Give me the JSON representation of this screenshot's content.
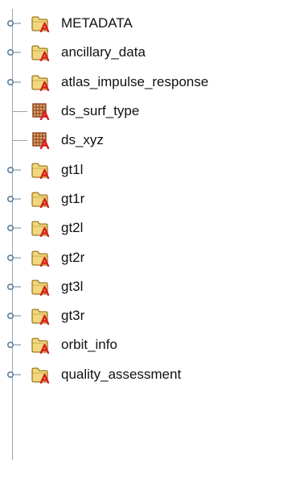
{
  "colors": {
    "folder_fill": "#f1d87e",
    "folder_stroke": "#a07820",
    "badge_red": "#d81e1e",
    "dataset_fill": "#d9a56b",
    "dataset_grid": "#8b3a1a",
    "tree_line": "#9aa6b2",
    "text": "#111111"
  },
  "tree": {
    "items": [
      {
        "label": "METADATA",
        "type": "group",
        "icon": "folder-icon",
        "expandable": true
      },
      {
        "label": "ancillary_data",
        "type": "group",
        "icon": "folder-icon",
        "expandable": true
      },
      {
        "label": "atlas_impulse_response",
        "type": "group",
        "icon": "folder-icon",
        "expandable": true
      },
      {
        "label": "ds_surf_type",
        "type": "dataset",
        "icon": "dataset-icon",
        "expandable": false
      },
      {
        "label": "ds_xyz",
        "type": "dataset",
        "icon": "dataset-icon",
        "expandable": false
      },
      {
        "label": "gt1l",
        "type": "group",
        "icon": "folder-icon",
        "expandable": true
      },
      {
        "label": "gt1r",
        "type": "group",
        "icon": "folder-icon",
        "expandable": true
      },
      {
        "label": "gt2l",
        "type": "group",
        "icon": "folder-icon",
        "expandable": true
      },
      {
        "label": "gt2r",
        "type": "group",
        "icon": "folder-icon",
        "expandable": true
      },
      {
        "label": "gt3l",
        "type": "group",
        "icon": "folder-icon",
        "expandable": true
      },
      {
        "label": "gt3r",
        "type": "group",
        "icon": "folder-icon",
        "expandable": true
      },
      {
        "label": "orbit_info",
        "type": "group",
        "icon": "folder-icon",
        "expandable": true
      },
      {
        "label": "quality_assessment",
        "type": "group",
        "icon": "folder-icon",
        "expandable": true
      }
    ]
  }
}
